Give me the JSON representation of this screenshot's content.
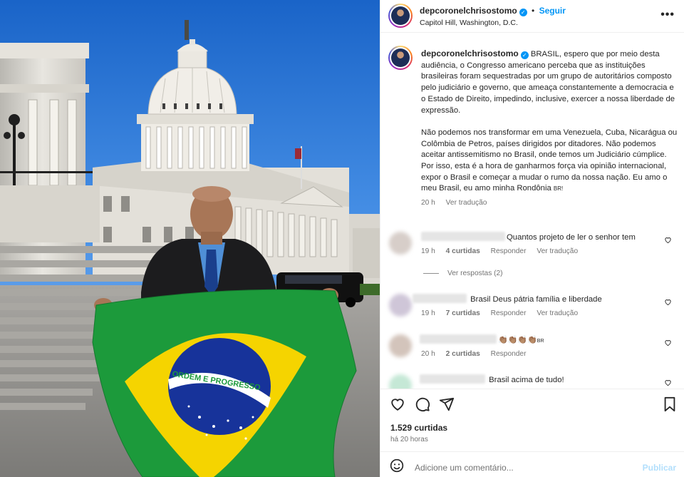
{
  "header": {
    "username": "depcoronelchrisostomo",
    "follow_label": "Seguir",
    "location": "Capitol Hill, Washington, D.C.",
    "more_icon": "more-horizontal-icon"
  },
  "caption": {
    "username": "depcoronelchrisostomo",
    "paragraph1": "BRASIL, espero que por meio desta audiência, o Congresso americano perceba que as instituições brasileiras foram sequestradas por um grupo de autoritários composto pelo judiciário e governo, que ameaça constantemente a democracia e o Estado de Direito, impedindo, inclusive, exercer a nossa liberdade de expressão.",
    "paragraph2": "Não podemos nos transformar em uma Venezuela, Cuba, Nicarágua ou Colômbia de Petros, países dirigidos por ditadores. Não podemos aceitar antissemitismo no Brasil, onde temos um Judiciário cúmplice. Por isso, esta é a hora de ganharmos força via opinião internacional, expor o Brasil e começar a mudar o rumo da nossa nação. Eu amo o meu Brasil, eu amo minha Rondônia",
    "flag_emoji": "BR!",
    "time": "20 h",
    "translate_label": "Ver tradução"
  },
  "comments": [
    {
      "text": "Quantos projeto de ler o senhor tem",
      "time": "19 h",
      "likes": "4 curtidas",
      "reply": "Responder",
      "translate": "Ver tradução",
      "view_replies": "Ver respostas (2)"
    },
    {
      "text": "Brasil Deus pátria família e liberdade",
      "time": "19 h",
      "likes": "7 curtidas",
      "reply": "Responder",
      "translate": "Ver tradução"
    },
    {
      "text": "👏🏽👏🏽👏🏽👏🏽",
      "flag_suffix": "BR",
      "time": "20 h",
      "likes": "2 curtidas",
      "reply": "Responder"
    },
    {
      "text": "Brasil acima de tudo!"
    }
  ],
  "photo": {
    "flag_motto": "ORDEM E PROGRESSO"
  },
  "actions": {
    "likes": "1.529 curtidas",
    "posted": "há 20 horas",
    "icons": [
      "heart-icon",
      "comment-icon",
      "share-icon",
      "bookmark-icon"
    ]
  },
  "add_comment": {
    "placeholder": "Adicione um comentário...",
    "publish_label": "Publicar"
  },
  "colors": {
    "accent": "#0095f6",
    "muted": "#737373",
    "border": "#efefef"
  }
}
